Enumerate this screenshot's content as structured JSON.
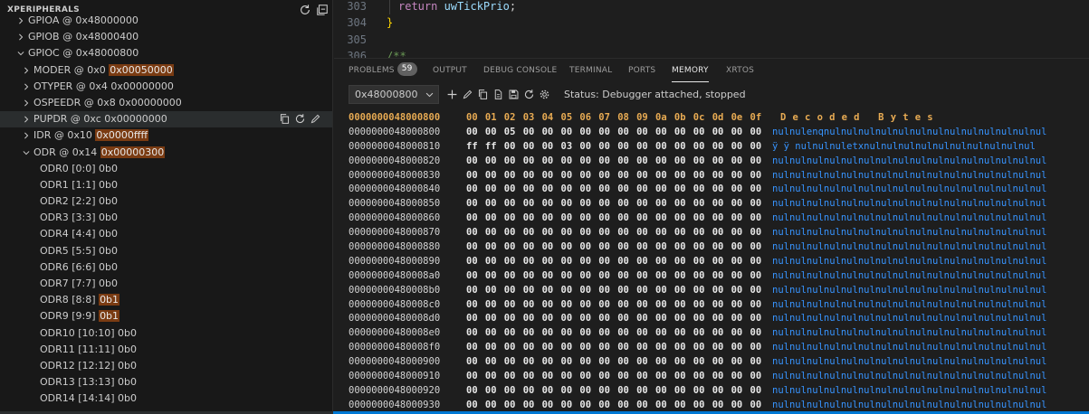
{
  "sidebar": {
    "title": "XPERIPHERALS",
    "header_icons": [
      "refresh-icon",
      "collapse-all-icon"
    ],
    "tree": [
      {
        "label": "GPIOA @ 0x48000000",
        "highlight": "",
        "level": 1,
        "expanded": false
      },
      {
        "label": "GPIOB @ 0x48000400",
        "highlight": "",
        "level": 1,
        "expanded": false
      },
      {
        "label": "GPIOC @ 0x48000800",
        "highlight": "",
        "level": 1,
        "expanded": true
      },
      {
        "label": "MODER @ 0x0 ",
        "highlight": "0x00050000",
        "level": 2,
        "expanded": false
      },
      {
        "label": "OTYPER @ 0x4 0x00000000",
        "highlight": "",
        "level": 2,
        "expanded": false
      },
      {
        "label": "OSPEEDR @ 0x8 0x00000000",
        "highlight": "",
        "level": 2,
        "expanded": false
      },
      {
        "label": "PUPDR @ 0xc 0x00000000",
        "highlight": "",
        "level": 2,
        "expanded": false,
        "selected": true
      },
      {
        "label": "IDR @ 0x10 ",
        "highlight": "0x0000ffff",
        "level": 2,
        "expanded": false
      },
      {
        "label": "ODR @ 0x14 ",
        "highlight": "0x00000300",
        "level": 2,
        "expanded": true
      },
      {
        "label": "ODR0 [0:0] 0b0",
        "highlight": "",
        "level": 3
      },
      {
        "label": "ODR1 [1:1] 0b0",
        "highlight": "",
        "level": 3
      },
      {
        "label": "ODR2 [2:2] 0b0",
        "highlight": "",
        "level": 3
      },
      {
        "label": "ODR3 [3:3] 0b0",
        "highlight": "",
        "level": 3
      },
      {
        "label": "ODR4 [4:4] 0b0",
        "highlight": "",
        "level": 3
      },
      {
        "label": "ODR5 [5:5] 0b0",
        "highlight": "",
        "level": 3
      },
      {
        "label": "ODR6 [6:6] 0b0",
        "highlight": "",
        "level": 3
      },
      {
        "label": "ODR7 [7:7] 0b0",
        "highlight": "",
        "level": 3
      },
      {
        "label": "ODR8 [8:8] ",
        "highlight": "0b1",
        "level": 3
      },
      {
        "label": "ODR9 [9:9] ",
        "highlight": "0b1",
        "level": 3
      },
      {
        "label": "ODR10 [10:10] 0b0",
        "highlight": "",
        "level": 3
      },
      {
        "label": "ODR11 [11:11] 0b0",
        "highlight": "",
        "level": 3
      },
      {
        "label": "ODR12 [12:12] 0b0",
        "highlight": "",
        "level": 3
      },
      {
        "label": "ODR13 [13:13] 0b0",
        "highlight": "",
        "level": 3
      },
      {
        "label": "ODR14 [14:14] 0b0",
        "highlight": "",
        "level": 3
      }
    ],
    "row_actions": [
      "copy-icon",
      "refresh-icon",
      "edit-icon"
    ]
  },
  "editor": {
    "lines": [
      {
        "num": "303",
        "code": [
          {
            "t": "return",
            "c": "kw"
          },
          {
            "t": " uwTickPrio",
            "c": "id"
          },
          {
            "t": ";",
            "c": "pn"
          }
        ],
        "indent": true
      },
      {
        "num": "304",
        "code": [
          {
            "t": "}",
            "c": "br"
          }
        ]
      },
      {
        "num": "305",
        "code": []
      },
      {
        "num": "306",
        "code": [
          {
            "t": "/**",
            "c": "cm"
          }
        ]
      }
    ]
  },
  "panel": {
    "tabs": [
      {
        "label": "PROBLEMS",
        "badge": "59",
        "active": false
      },
      {
        "label": "OUTPUT",
        "active": false
      },
      {
        "label": "DEBUG CONSOLE",
        "active": false
      },
      {
        "label": "TERMINAL",
        "active": false
      },
      {
        "label": "PORTS",
        "active": false
      },
      {
        "label": "MEMORY",
        "active": true
      },
      {
        "label": "XRTOS",
        "active": false
      }
    ],
    "address_value": "0x48000800",
    "toolbar_icons": [
      "add-icon",
      "edit-icon",
      "copy-icon",
      "document-icon",
      "save-icon",
      "refresh-icon",
      "settings-icon"
    ],
    "status": "Status: Debugger attached, stopped"
  },
  "memory": {
    "header": {
      "address": "0000000048000800",
      "bytes": [
        "00",
        "01",
        "02",
        "03",
        "04",
        "05",
        "06",
        "07",
        "08",
        "09",
        "0a",
        "0b",
        "0c",
        "0d",
        "0e",
        "0f"
      ],
      "decoded": "Decoded Bytes"
    },
    "rows": [
      {
        "address": "0000000048000800",
        "bytes": [
          "00",
          "00",
          "05",
          "00",
          "00",
          "00",
          "00",
          "00",
          "00",
          "00",
          "00",
          "00",
          "00",
          "00",
          "00",
          "00"
        ],
        "decoded": "nulnulenqnulnulnulnulnulnulnulnulnulnulnulnulnul"
      },
      {
        "address": "0000000048000810",
        "bytes": [
          "ff",
          "ff",
          "00",
          "00",
          "00",
          "03",
          "00",
          "00",
          "00",
          "00",
          "00",
          "00",
          "00",
          "00",
          "00",
          "00"
        ],
        "decoded": " ÿ  ÿ nulnulnuletxnulnulnulnulnulnulnulnulnulnul"
      },
      {
        "address": "0000000048000820",
        "bytes": [
          "00",
          "00",
          "00",
          "00",
          "00",
          "00",
          "00",
          "00",
          "00",
          "00",
          "00",
          "00",
          "00",
          "00",
          "00",
          "00"
        ],
        "decoded": "nulnulnulnulnulnulnulnulnulnulnulnulnulnulnulnul"
      },
      {
        "address": "0000000048000830",
        "bytes": [
          "00",
          "00",
          "00",
          "00",
          "00",
          "00",
          "00",
          "00",
          "00",
          "00",
          "00",
          "00",
          "00",
          "00",
          "00",
          "00"
        ],
        "decoded": "nulnulnulnulnulnulnulnulnulnulnulnulnulnulnulnul"
      },
      {
        "address": "0000000048000840",
        "bytes": [
          "00",
          "00",
          "00",
          "00",
          "00",
          "00",
          "00",
          "00",
          "00",
          "00",
          "00",
          "00",
          "00",
          "00",
          "00",
          "00"
        ],
        "decoded": "nulnulnulnulnulnulnulnulnulnulnulnulnulnulnulnul"
      },
      {
        "address": "0000000048000850",
        "bytes": [
          "00",
          "00",
          "00",
          "00",
          "00",
          "00",
          "00",
          "00",
          "00",
          "00",
          "00",
          "00",
          "00",
          "00",
          "00",
          "00"
        ],
        "decoded": "nulnulnulnulnulnulnulnulnulnulnulnulnulnulnulnul"
      },
      {
        "address": "0000000048000860",
        "bytes": [
          "00",
          "00",
          "00",
          "00",
          "00",
          "00",
          "00",
          "00",
          "00",
          "00",
          "00",
          "00",
          "00",
          "00",
          "00",
          "00"
        ],
        "decoded": "nulnulnulnulnulnulnulnulnulnulnulnulnulnulnulnul"
      },
      {
        "address": "0000000048000870",
        "bytes": [
          "00",
          "00",
          "00",
          "00",
          "00",
          "00",
          "00",
          "00",
          "00",
          "00",
          "00",
          "00",
          "00",
          "00",
          "00",
          "00"
        ],
        "decoded": "nulnulnulnulnulnulnulnulnulnulnulnulnulnulnulnul"
      },
      {
        "address": "0000000048000880",
        "bytes": [
          "00",
          "00",
          "00",
          "00",
          "00",
          "00",
          "00",
          "00",
          "00",
          "00",
          "00",
          "00",
          "00",
          "00",
          "00",
          "00"
        ],
        "decoded": "nulnulnulnulnulnulnulnulnulnulnulnulnulnulnulnul"
      },
      {
        "address": "0000000048000890",
        "bytes": [
          "00",
          "00",
          "00",
          "00",
          "00",
          "00",
          "00",
          "00",
          "00",
          "00",
          "00",
          "00",
          "00",
          "00",
          "00",
          "00"
        ],
        "decoded": "nulnulnulnulnulnulnulnulnulnulnulnulnulnulnulnul"
      },
      {
        "address": "00000000480008a0",
        "bytes": [
          "00",
          "00",
          "00",
          "00",
          "00",
          "00",
          "00",
          "00",
          "00",
          "00",
          "00",
          "00",
          "00",
          "00",
          "00",
          "00"
        ],
        "decoded": "nulnulnulnulnulnulnulnulnulnulnulnulnulnulnulnul"
      },
      {
        "address": "00000000480008b0",
        "bytes": [
          "00",
          "00",
          "00",
          "00",
          "00",
          "00",
          "00",
          "00",
          "00",
          "00",
          "00",
          "00",
          "00",
          "00",
          "00",
          "00"
        ],
        "decoded": "nulnulnulnulnulnulnulnulnulnulnulnulnulnulnulnul"
      },
      {
        "address": "00000000480008c0",
        "bytes": [
          "00",
          "00",
          "00",
          "00",
          "00",
          "00",
          "00",
          "00",
          "00",
          "00",
          "00",
          "00",
          "00",
          "00",
          "00",
          "00"
        ],
        "decoded": "nulnulnulnulnulnulnulnulnulnulnulnulnulnulnulnul"
      },
      {
        "address": "00000000480008d0",
        "bytes": [
          "00",
          "00",
          "00",
          "00",
          "00",
          "00",
          "00",
          "00",
          "00",
          "00",
          "00",
          "00",
          "00",
          "00",
          "00",
          "00"
        ],
        "decoded": "nulnulnulnulnulnulnulnulnulnulnulnulnulnulnulnul"
      },
      {
        "address": "00000000480008e0",
        "bytes": [
          "00",
          "00",
          "00",
          "00",
          "00",
          "00",
          "00",
          "00",
          "00",
          "00",
          "00",
          "00",
          "00",
          "00",
          "00",
          "00"
        ],
        "decoded": "nulnulnulnulnulnulnulnulnulnulnulnulnulnulnulnul"
      },
      {
        "address": "00000000480008f0",
        "bytes": [
          "00",
          "00",
          "00",
          "00",
          "00",
          "00",
          "00",
          "00",
          "00",
          "00",
          "00",
          "00",
          "00",
          "00",
          "00",
          "00"
        ],
        "decoded": "nulnulnulnulnulnulnulnulnulnulnulnulnulnulnulnul"
      },
      {
        "address": "0000000048000900",
        "bytes": [
          "00",
          "00",
          "00",
          "00",
          "00",
          "00",
          "00",
          "00",
          "00",
          "00",
          "00",
          "00",
          "00",
          "00",
          "00",
          "00"
        ],
        "decoded": "nulnulnulnulnulnulnulnulnulnulnulnulnulnulnulnul"
      },
      {
        "address": "0000000048000910",
        "bytes": [
          "00",
          "00",
          "00",
          "00",
          "00",
          "00",
          "00",
          "00",
          "00",
          "00",
          "00",
          "00",
          "00",
          "00",
          "00",
          "00"
        ],
        "decoded": "nulnulnulnulnulnulnulnulnulnulnulnulnulnulnulnul"
      },
      {
        "address": "0000000048000920",
        "bytes": [
          "00",
          "00",
          "00",
          "00",
          "00",
          "00",
          "00",
          "00",
          "00",
          "00",
          "00",
          "00",
          "00",
          "00",
          "00",
          "00"
        ],
        "decoded": "nulnulnulnulnulnulnulnulnulnulnulnulnulnulnulnul"
      },
      {
        "address": "0000000048000930",
        "bytes": [
          "00",
          "00",
          "00",
          "00",
          "00",
          "00",
          "00",
          "00",
          "00",
          "00",
          "00",
          "00",
          "00",
          "00",
          "00",
          "00"
        ],
        "decoded": "nulnulnulnulnulnulnulnulnulnulnulnulnulnulnulnul"
      }
    ]
  },
  "colors": {
    "accent": "#0078d4",
    "highlight_value": "#7a3b12",
    "memory_header": "#e8ab53",
    "decoded_text": "#3794ff"
  }
}
